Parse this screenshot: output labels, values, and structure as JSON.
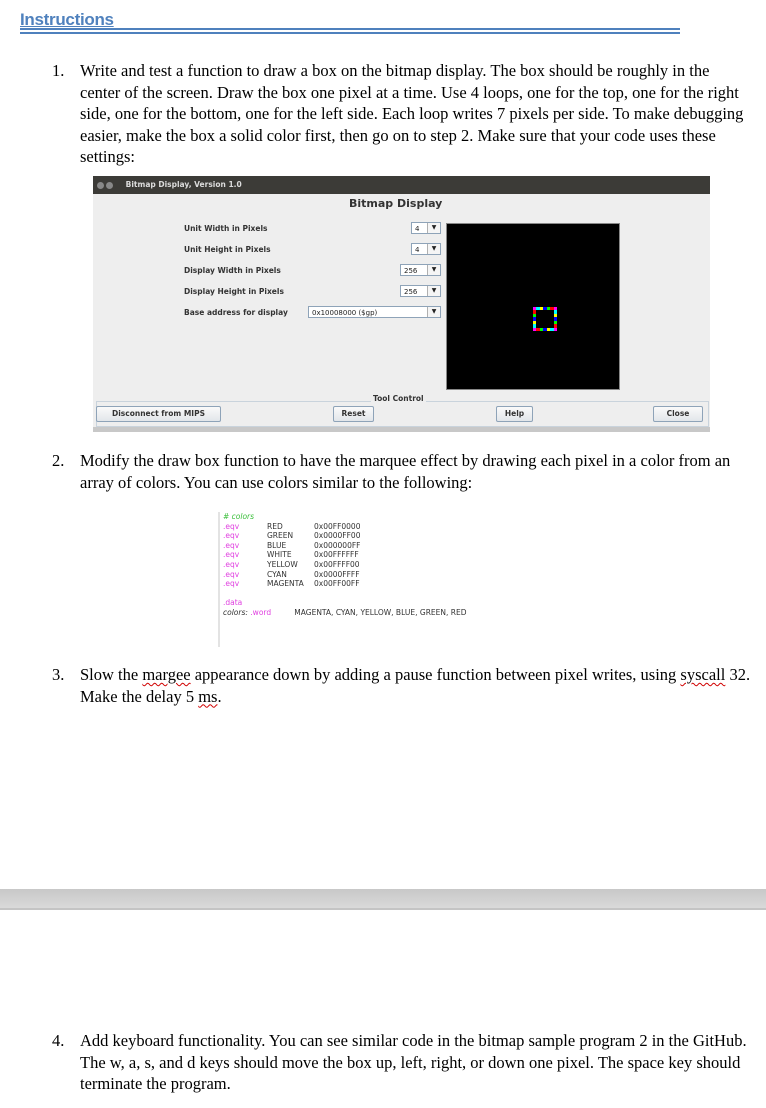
{
  "heading": "Instructions",
  "items": [
    {
      "number": "1.",
      "text": "Write and test a function to draw a box on the bitmap display. The box should be roughly in the center of the screen. Draw the box one pixel at a time. Use 4 loops, one for the top, one for the right side, one for the bottom, one for the left side. Each loop writes 7 pixels per side. To make debugging easier, make the box a solid color first, then go on to step 2. Make sure that your code uses these settings:"
    },
    {
      "number": "2.",
      "text": "Modify the draw box function to have the marquee effect by drawing each pixel in a color from an array of colors. You can use colors similar to the following:"
    },
    {
      "number": "3.",
      "text_a": "Slow the ",
      "misspelled_1": "margee",
      "text_b": " appearance down by adding a pause function between pixel writes, using ",
      "misspelled_2": "syscall",
      "text_c": " 32. Make the delay 5 ",
      "misspelled_3": "ms",
      "text_d": "."
    },
    {
      "number": "4.",
      "text": "Add keyboard functionality. You can see similar code in the bitmap sample program 2 in the GitHub. The w, a, s, and d keys should move the box up, left, right, or down one pixel. The space key should terminate the program."
    }
  ],
  "bitmap_window": {
    "title": "Bitmap Display, Version 1.0",
    "panel_title": "Bitmap Display",
    "settings": [
      {
        "label": "Unit Width in Pixels",
        "value": "4"
      },
      {
        "label": "Unit Height in Pixels",
        "value": "4"
      },
      {
        "label": "Display Width in Pixels",
        "value": "256"
      },
      {
        "label": "Display Height in Pixels",
        "value": "256"
      },
      {
        "label": "Base address for display",
        "value": "0x10008000 ($gp)"
      }
    ],
    "tool_control_label": "Tool Control",
    "buttons": {
      "disconnect": "Disconnect from MIPS",
      "reset": "Reset",
      "help": "Help",
      "close": "Close"
    },
    "box_pixel_colors": [
      "#ff00ff",
      "#00ffff",
      "#ffff00",
      "#0000ff",
      "#00ff00",
      "#ff0000"
    ]
  },
  "code": {
    "comment": "# colors",
    "eqv": [
      {
        "directive": ".eqv",
        "name": "RED",
        "value": "0x00FF0000"
      },
      {
        "directive": ".eqv",
        "name": "GREEN",
        "value": "0x0000FF00"
      },
      {
        "directive": ".eqv",
        "name": "BLUE",
        "value": "0x000000FF"
      },
      {
        "directive": ".eqv",
        "name": "WHITE",
        "value": "0x00FFFFFF"
      },
      {
        "directive": ".eqv",
        "name": "YELLOW",
        "value": "0x00FFFF00"
      },
      {
        "directive": ".eqv",
        "name": "CYAN",
        "value": "0x0000FFFF"
      },
      {
        "directive": ".eqv",
        "name": "MAGENTA",
        "value": "0x00FF00FF"
      }
    ],
    "data_directive": ".data",
    "colors_label": "colors:",
    "word_directive": ".word",
    "colors_list": "MAGENTA, CYAN, YELLOW, BLUE, GREEN, RED"
  }
}
